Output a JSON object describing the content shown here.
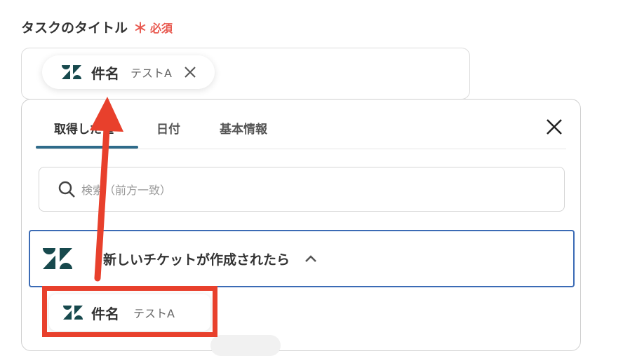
{
  "field": {
    "label": "タスクのタイトル",
    "required_star": "＊",
    "required_text": "必須"
  },
  "chip": {
    "name": "件名",
    "value": "テストA"
  },
  "panel": {
    "tabs": [
      {
        "label": "取得した値",
        "active": true
      },
      {
        "label": "日付",
        "active": false
      },
      {
        "label": "基本情報",
        "active": false
      }
    ],
    "search_placeholder": "検索（前方一致）",
    "section_label": "新しいチケットが作成されたら",
    "result": {
      "name": "件名",
      "value": "テストA"
    }
  },
  "colors": {
    "accent": "#2f6b8a",
    "required": "#e8594f",
    "highlight": "#e8402c",
    "section_border": "#3b6bb5",
    "logo": "#17494d"
  }
}
